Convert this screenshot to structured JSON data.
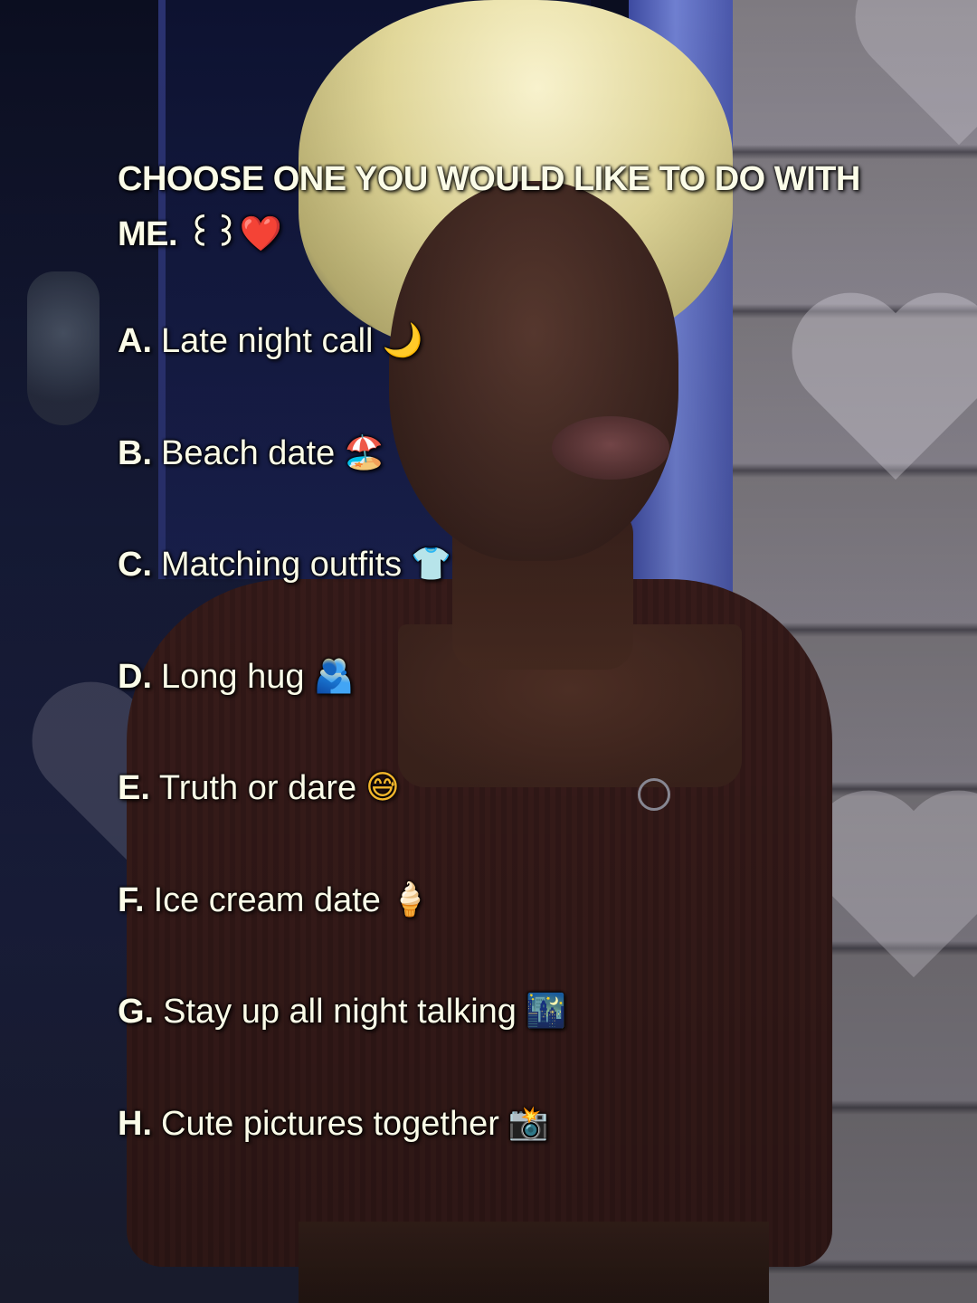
{
  "post": {
    "title": "CHOOSE ONE YOU WOULD LIKE TO DO WITH ME. ꒰꒱❤️",
    "options": [
      {
        "letter": "A.",
        "text": "Late night call",
        "emoji": "🌙",
        "emoji_name": "crescent-moon-icon",
        "emoji_color": "#e8b93a"
      },
      {
        "letter": "B.",
        "text": "Beach date",
        "emoji": "🏖️",
        "emoji_name": "beach-umbrella-icon",
        "emoji_color": "#e36a3c"
      },
      {
        "letter": "C.",
        "text": "Matching outfits",
        "emoji": "👕",
        "emoji_name": "t-shirt-icon",
        "emoji_color": "#7fd4e6"
      },
      {
        "letter": "D.",
        "text": "Long hug",
        "emoji": "🫂",
        "emoji_name": "people-hugging-icon",
        "emoji_color": "#4fb6d8"
      },
      {
        "letter": "E.",
        "text": "Truth or dare",
        "emoji": "😅",
        "emoji_name": "grinning-sweat-face-icon",
        "emoji_color": "#f3b72c"
      },
      {
        "letter": "F.",
        "text": "Ice cream date",
        "emoji": "🍦",
        "emoji_name": "ice-cream-icon",
        "emoji_color": "#f0c48a"
      },
      {
        "letter": "G.",
        "text": "Stay up all night talking",
        "emoji": "🌃",
        "emoji_name": "night-city-icon",
        "emoji_color": "#3a6fa8"
      },
      {
        "letter": "H.",
        "text": "Cute pictures together",
        "emoji": "📸",
        "emoji_name": "camera-flash-icon",
        "emoji_color": "#4ba3d6"
      }
    ]
  },
  "colors": {
    "text": "#fbfce8",
    "hair": "#f0e7b0",
    "top": "#3c1e1c",
    "door": "#151a36",
    "siding": "#7e7a80"
  }
}
